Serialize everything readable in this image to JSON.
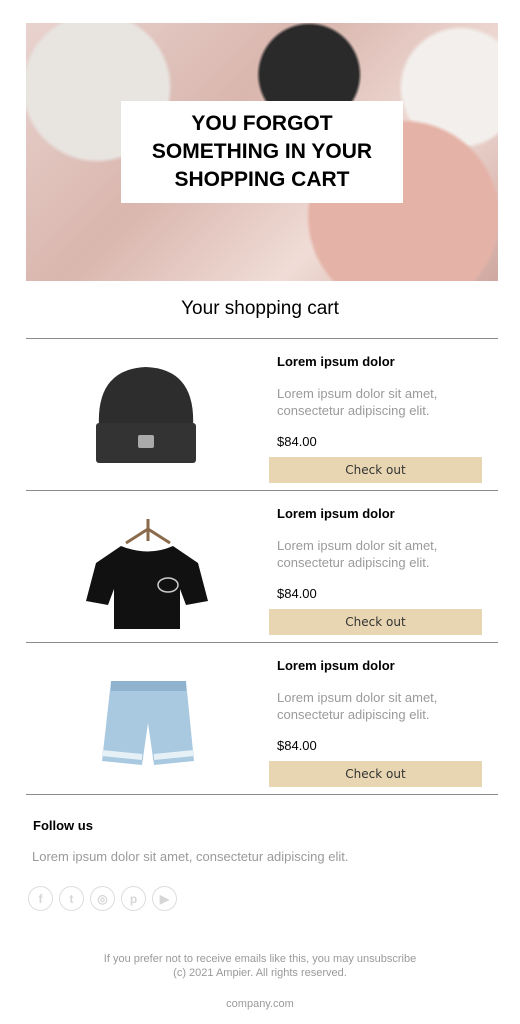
{
  "hero": {
    "title": "YOU FORGOT\nSOMETHING IN YOUR\nSHOPPING CART"
  },
  "cart": {
    "title": "Your shopping cart",
    "items": [
      {
        "name": "Lorem ipsum dolor",
        "description": "Lorem ipsum dolor sit amet, consectetur adipiscing elit.",
        "price": "$84.00",
        "button": "Check out",
        "image": "black-beanie"
      },
      {
        "name": "Lorem ipsum dolor",
        "description": "Lorem ipsum dolor sit amet, consectetur adipiscing elit.",
        "price": "$84.00",
        "button": "Check out",
        "image": "black-tshirt"
      },
      {
        "name": "Lorem ipsum dolor",
        "description": "Lorem ipsum dolor sit amet, consectetur adipiscing elit.",
        "price": "$84.00",
        "button": "Check out",
        "image": "denim-shorts"
      }
    ]
  },
  "follow": {
    "title": "Follow us",
    "text": "Lorem ipsum dolor sit amet, consectetur adipiscing elit.",
    "icons": [
      "facebook-icon",
      "twitter-icon",
      "instagram-icon",
      "pinterest-icon",
      "youtube-icon"
    ]
  },
  "footer": {
    "unsubscribe": "If you prefer not to receive emails like this, you may unsubscribe",
    "copyright": "(c) 2021 Ampier. All rights reserved.",
    "website": "company.com"
  },
  "colors": {
    "button": "#e8d6b3",
    "muted_text": "#9a9a9a"
  }
}
